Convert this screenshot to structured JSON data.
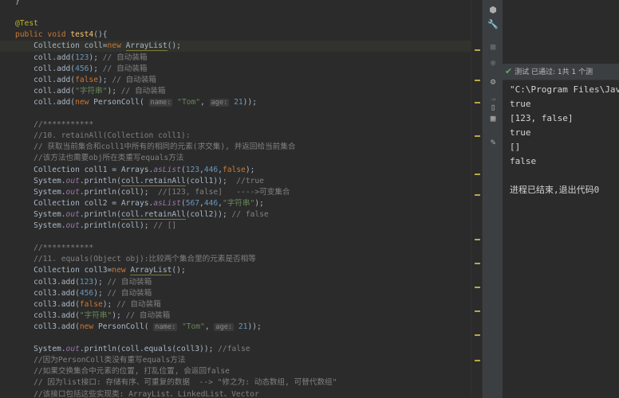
{
  "editor": {
    "lines": [
      {
        "tokens": [
          {
            "t": "}",
            "c": ""
          }
        ]
      },
      {
        "tokens": []
      },
      {
        "tokens": [
          {
            "t": "@Test",
            "c": "ann"
          }
        ]
      },
      {
        "tokens": [
          {
            "t": "public void ",
            "c": "kw"
          },
          {
            "t": "test4",
            "c": "fn"
          },
          {
            "t": "(){",
            "c": ""
          }
        ]
      },
      {
        "hl": true,
        "tokens": [
          {
            "t": "    Collection coll=",
            "c": ""
          },
          {
            "t": "new ",
            "c": "kw"
          },
          {
            "t": "ArrayList",
            "c": "wavy"
          },
          {
            "t": "();",
            "c": ""
          }
        ]
      },
      {
        "tokens": [
          {
            "t": "    coll.add(",
            "c": ""
          },
          {
            "t": "123",
            "c": "num"
          },
          {
            "t": "); ",
            "c": ""
          },
          {
            "t": "// 自动装箱",
            "c": "com"
          }
        ]
      },
      {
        "tokens": [
          {
            "t": "    coll.add(",
            "c": ""
          },
          {
            "t": "456",
            "c": "num"
          },
          {
            "t": "); ",
            "c": ""
          },
          {
            "t": "// 自动装箱",
            "c": "com"
          }
        ]
      },
      {
        "tokens": [
          {
            "t": "    coll.add(",
            "c": ""
          },
          {
            "t": "false",
            "c": "kw"
          },
          {
            "t": "); ",
            "c": ""
          },
          {
            "t": "// 自动装箱",
            "c": "com"
          }
        ]
      },
      {
        "tokens": [
          {
            "t": "    coll.add(",
            "c": ""
          },
          {
            "t": "\"字符串\"",
            "c": "str"
          },
          {
            "t": "); ",
            "c": ""
          },
          {
            "t": "// 自动装箱",
            "c": "com"
          }
        ]
      },
      {
        "tokens": [
          {
            "t": "    coll.add(",
            "c": ""
          },
          {
            "t": "new ",
            "c": "kw"
          },
          {
            "t": "PersonColl( ",
            "c": ""
          },
          {
            "t": "name:",
            "c": "hint"
          },
          {
            "t": " ",
            "c": ""
          },
          {
            "t": "\"Tom\"",
            "c": "str"
          },
          {
            "t": ", ",
            "c": ""
          },
          {
            "t": "age:",
            "c": "hint"
          },
          {
            "t": " ",
            "c": ""
          },
          {
            "t": "21",
            "c": "num"
          },
          {
            "t": "));",
            "c": ""
          }
        ]
      },
      {
        "tokens": []
      },
      {
        "tokens": [
          {
            "t": "    //***********",
            "c": "com"
          }
        ]
      },
      {
        "tokens": [
          {
            "t": "    //10. retainAll(Collection coll1):",
            "c": "com"
          }
        ]
      },
      {
        "tokens": [
          {
            "t": "    // 获取当前集合和coll1中所有的相同的元素(求交集), 并返回给当前集合",
            "c": "com"
          }
        ]
      },
      {
        "tokens": [
          {
            "t": "    //该方法也需要obj所在类重写equals方法",
            "c": "com"
          }
        ]
      },
      {
        "tokens": [
          {
            "t": "    Collection coll1 = Arrays.",
            "c": ""
          },
          {
            "t": "asList",
            "c": "stat"
          },
          {
            "t": "(",
            "c": ""
          },
          {
            "t": "123",
            "c": "num"
          },
          {
            "t": ",",
            "c": ""
          },
          {
            "t": "446",
            "c": "num"
          },
          {
            "t": ",",
            "c": ""
          },
          {
            "t": "false",
            "c": "kw"
          },
          {
            "t": ");",
            "c": ""
          }
        ]
      },
      {
        "tokens": [
          {
            "t": "    System.",
            "c": ""
          },
          {
            "t": "out",
            "c": "stat"
          },
          {
            "t": ".println(",
            "c": ""
          },
          {
            "t": "coll.retainAll",
            "c": "wavy"
          },
          {
            "t": "(coll1));  ",
            "c": ""
          },
          {
            "t": "//true",
            "c": "com"
          }
        ]
      },
      {
        "tokens": [
          {
            "t": "    System.",
            "c": ""
          },
          {
            "t": "out",
            "c": "stat"
          },
          {
            "t": ".println(coll);  ",
            "c": ""
          },
          {
            "t": "//[123, false]   ---->可变集合",
            "c": "com"
          }
        ]
      },
      {
        "tokens": [
          {
            "t": "    Collection coll2 = Arrays.",
            "c": ""
          },
          {
            "t": "asList",
            "c": "stat"
          },
          {
            "t": "(",
            "c": ""
          },
          {
            "t": "567",
            "c": "num"
          },
          {
            "t": ",",
            "c": ""
          },
          {
            "t": "446",
            "c": "num"
          },
          {
            "t": ",",
            "c": ""
          },
          {
            "t": "\"字符串\"",
            "c": "str"
          },
          {
            "t": ");",
            "c": ""
          }
        ]
      },
      {
        "tokens": [
          {
            "t": "    System.",
            "c": ""
          },
          {
            "t": "out",
            "c": "stat"
          },
          {
            "t": ".println(",
            "c": ""
          },
          {
            "t": "coll.retainAll",
            "c": "wavy"
          },
          {
            "t": "(coll2)); ",
            "c": ""
          },
          {
            "t": "// false",
            "c": "com"
          }
        ]
      },
      {
        "tokens": [
          {
            "t": "    System.",
            "c": ""
          },
          {
            "t": "out",
            "c": "stat"
          },
          {
            "t": ".println(coll); ",
            "c": ""
          },
          {
            "t": "// []",
            "c": "com"
          }
        ]
      },
      {
        "tokens": []
      },
      {
        "tokens": [
          {
            "t": "    //***********",
            "c": "com"
          }
        ]
      },
      {
        "tokens": [
          {
            "t": "    //11. equals(Object obj):比较两个集合里的元素是否相等",
            "c": "com"
          }
        ]
      },
      {
        "tokens": [
          {
            "t": "    Collection coll3=",
            "c": ""
          },
          {
            "t": "new ",
            "c": "kw"
          },
          {
            "t": "ArrayList",
            "c": "wavy"
          },
          {
            "t": "();",
            "c": ""
          }
        ]
      },
      {
        "tokens": [
          {
            "t": "    coll3.add(",
            "c": ""
          },
          {
            "t": "123",
            "c": "num"
          },
          {
            "t": "); ",
            "c": ""
          },
          {
            "t": "// 自动装箱",
            "c": "com"
          }
        ]
      },
      {
        "tokens": [
          {
            "t": "    coll3.add(",
            "c": ""
          },
          {
            "t": "456",
            "c": "num"
          },
          {
            "t": "); ",
            "c": ""
          },
          {
            "t": "// 自动装箱",
            "c": "com"
          }
        ]
      },
      {
        "tokens": [
          {
            "t": "    coll3.add(",
            "c": ""
          },
          {
            "t": "false",
            "c": "kw"
          },
          {
            "t": "); ",
            "c": ""
          },
          {
            "t": "// 自动装箱",
            "c": "com"
          }
        ]
      },
      {
        "tokens": [
          {
            "t": "    coll3.add(",
            "c": ""
          },
          {
            "t": "\"字符串\"",
            "c": "str"
          },
          {
            "t": "); ",
            "c": ""
          },
          {
            "t": "// 自动装箱",
            "c": "com"
          }
        ]
      },
      {
        "tokens": [
          {
            "t": "    coll3.add(",
            "c": ""
          },
          {
            "t": "new ",
            "c": "kw"
          },
          {
            "t": "PersonColl( ",
            "c": ""
          },
          {
            "t": "name:",
            "c": "hint"
          },
          {
            "t": " ",
            "c": ""
          },
          {
            "t": "\"Tom\"",
            "c": "str"
          },
          {
            "t": ", ",
            "c": ""
          },
          {
            "t": "age:",
            "c": "hint"
          },
          {
            "t": " ",
            "c": ""
          },
          {
            "t": "21",
            "c": "num"
          },
          {
            "t": "));",
            "c": ""
          }
        ]
      },
      {
        "tokens": []
      },
      {
        "tokens": [
          {
            "t": "    System.",
            "c": ""
          },
          {
            "t": "out",
            "c": "stat"
          },
          {
            "t": ".println(coll.equals(coll3)); ",
            "c": ""
          },
          {
            "t": "//false",
            "c": "com"
          }
        ]
      },
      {
        "tokens": [
          {
            "t": "    //因为PersonColl类没有重写equals方法",
            "c": "com"
          }
        ]
      },
      {
        "tokens": [
          {
            "t": "    //如果交换集合中元素的位置, 打乱位置, 会返回false",
            "c": "com"
          }
        ]
      },
      {
        "tokens": [
          {
            "t": "    // 因为list接口: 存储有序、可重复的数据  --> \"修之为: 动态数组, 可替代数组\"",
            "c": "com"
          }
        ]
      },
      {
        "tokens": [
          {
            "t": "    //该接口包括这些实现类: ArrayList、LinkedList、Vector",
            "c": "com"
          }
        ]
      }
    ]
  },
  "tool_strip": {
    "icons": [
      "gradle-icon",
      "wrench-icon",
      "stop-icon",
      "camera-icon",
      "settings-icon",
      "login-icon",
      "trash-icon",
      "layout-icon",
      "pin-icon"
    ]
  },
  "run_panel": {
    "status_text": "测试 已通过: 1共 1 个测",
    "output": [
      "\"C:\\Program Files\\Jav",
      "true",
      "[123, false]",
      "true",
      "[]",
      "false",
      "",
      "进程已结束,退出代码0"
    ]
  },
  "colors": {
    "editor_bg": "#2b2b2b",
    "panel_bg": "#3c3f41",
    "keyword": "#cc7832",
    "string": "#6a8759",
    "number": "#6897bb",
    "comment": "#808080",
    "pass_green": "#59a869"
  }
}
